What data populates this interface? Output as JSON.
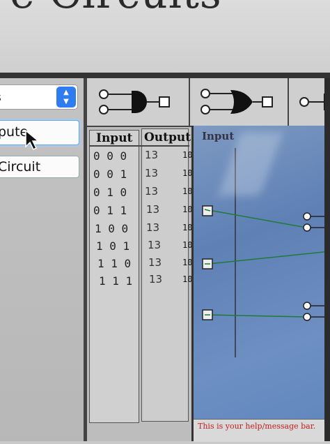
{
  "page": {
    "title": "e Circuits"
  },
  "left_panel": {
    "mode_select_label": "s",
    "compute_button": "pute",
    "circuit_button": "Circuit"
  },
  "toolbar": {
    "tools": [
      "and-gate-icon",
      "or-gate-icon",
      "not-gate-icon"
    ]
  },
  "truth_table": {
    "input_header": "Input",
    "output_header": "Output",
    "rows": [
      {
        "input": "0 0 0",
        "output": "13"
      },
      {
        "input": "0 0 1",
        "output": "13"
      },
      {
        "input": "0 1 0",
        "output": "13"
      },
      {
        "input": "0 1 1",
        "output": "13"
      },
      {
        "input": "1 0 0",
        "output": "13"
      },
      {
        "input": "1 0 1",
        "output": "13"
      },
      {
        "input": "1 1 0",
        "output": "13"
      },
      {
        "input": "1 1 1",
        "output": "13"
      }
    ],
    "row_tick": "10"
  },
  "canvas": {
    "input_label": "Input"
  },
  "status_bar": {
    "message": "This is your help/message bar."
  },
  "colors": {
    "canvas_blue": "#6a8cc0",
    "wire_green": "#1f7a3a",
    "status_red": "#c02020",
    "select_blue": "#2f7cf0"
  }
}
